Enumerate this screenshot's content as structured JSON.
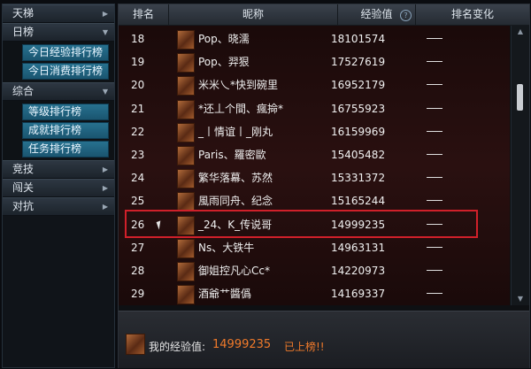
{
  "sidebar": {
    "categories": [
      {
        "label": "天梯"
      },
      {
        "label": "日榜",
        "items": [
          "今日经验排行榜",
          "今日消费排行榜"
        ]
      },
      {
        "label": "综合",
        "items": [
          "等级排行榜",
          "成就排行榜",
          "任务排行榜"
        ]
      },
      {
        "label": "竞技"
      },
      {
        "label": "闯关"
      },
      {
        "label": "对抗"
      }
    ]
  },
  "table": {
    "columns": [
      "排名",
      "昵称",
      "经验值",
      "排名变化"
    ],
    "help_glyph": "?",
    "rows": [
      {
        "rank": "18",
        "nick": "Pop、晓濡",
        "exp": "18101574"
      },
      {
        "rank": "19",
        "nick": "Pop、羿狠",
        "exp": "17527619"
      },
      {
        "rank": "20",
        "nick": "米米乀*快到碗里",
        "exp": "16952179"
      },
      {
        "rank": "21",
        "nick": "*还丄个間、瘋掵*",
        "exp": "16755923"
      },
      {
        "rank": "22",
        "nick": "_丨情谊丨_刚丸",
        "exp": "16159969"
      },
      {
        "rank": "23",
        "nick": "Paris、羅密歐",
        "exp": "15405482"
      },
      {
        "rank": "24",
        "nick": "繁华落幕、苏然",
        "exp": "15331372"
      },
      {
        "rank": "25",
        "nick": "風雨同舟、纪念",
        "exp": "15165244"
      },
      {
        "rank": "26",
        "nick": "_24、K_传说哥",
        "exp": "14999235"
      },
      {
        "rank": "27",
        "nick": "Ns、大铁牛",
        "exp": "14963131"
      },
      {
        "rank": "28",
        "nick": "御姐控凡心Cc*",
        "exp": "14220973"
      },
      {
        "rank": "29",
        "nick": "酒爺艹醬僞",
        "exp": "14169337"
      }
    ]
  },
  "footer": {
    "label": "我的经验值:",
    "value": "14999235",
    "status": "已上榜!!"
  },
  "colors": {
    "accent": "#f07a2a",
    "highlight": "#d0202a",
    "sub_item": "#1f6482"
  }
}
